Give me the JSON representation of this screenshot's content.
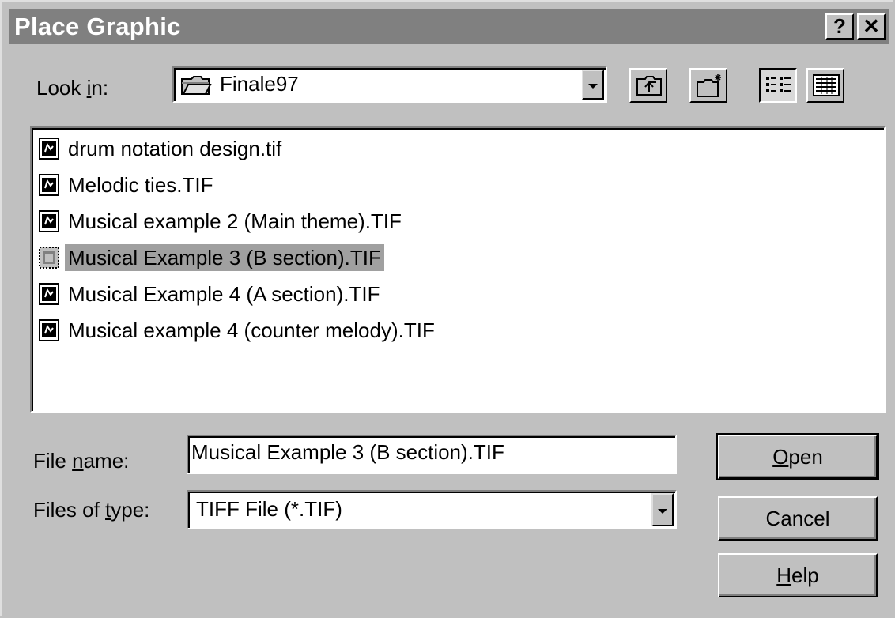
{
  "dialog": {
    "title": "Place Graphic",
    "help_button": "?",
    "close_button": "✕"
  },
  "look_in": {
    "label_prefix": "Look ",
    "label_accel": "i",
    "label_suffix": "n:",
    "value": "Finale97"
  },
  "toolbar": {
    "icons": [
      "up-one-level-icon",
      "create-new-folder-icon",
      "list-view-icon",
      "details-view-icon"
    ]
  },
  "files": [
    {
      "name": "drum notation design.tif",
      "selected": false
    },
    {
      "name": "Melodic ties.TIF",
      "selected": false
    },
    {
      "name": "Musical example 2 (Main theme).TIF",
      "selected": false
    },
    {
      "name": "Musical Example 3 (B section).TIF",
      "selected": true
    },
    {
      "name": "Musical Example 4 (A section).TIF",
      "selected": false
    },
    {
      "name": "Musical example 4 (counter melody).TIF",
      "selected": false
    }
  ],
  "file_name": {
    "label_prefix": "File ",
    "label_accel": "n",
    "label_suffix": "ame:",
    "value": "Musical Example 3 (B section).TIF"
  },
  "files_of_type": {
    "label_prefix": "Files of ",
    "label_accel": "t",
    "label_suffix": "ype:",
    "value": "TIFF File (*.TIF)"
  },
  "buttons": {
    "open_accel": "O",
    "open_rest": "pen",
    "cancel": "Cancel",
    "help_accel": "H",
    "help_rest": "elp"
  }
}
